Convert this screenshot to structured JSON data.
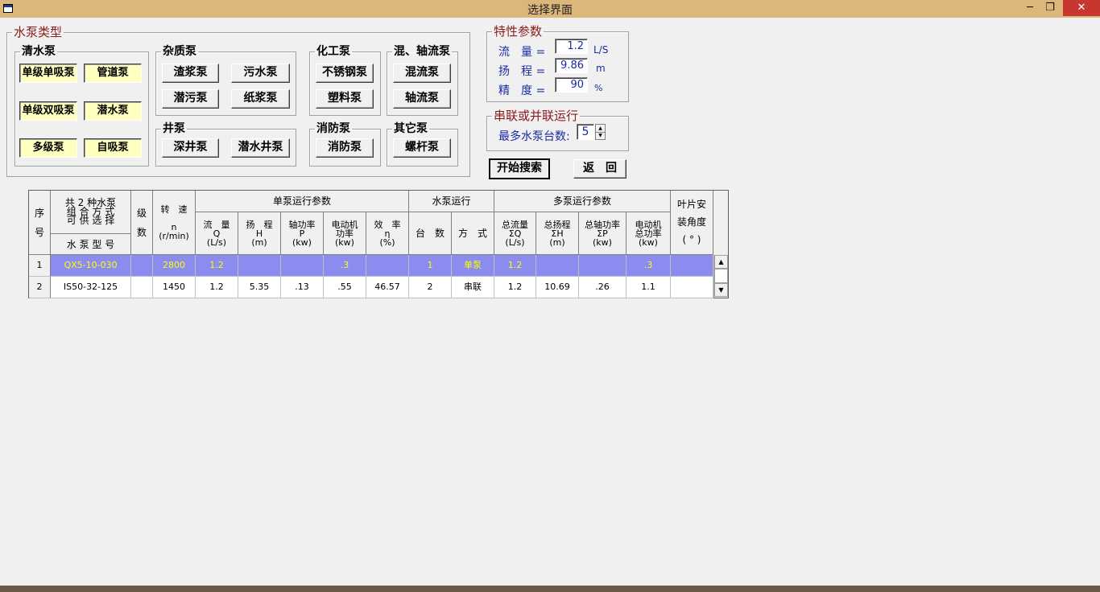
{
  "window": {
    "title": "选择界面",
    "minimize": "─",
    "restore": "❐",
    "close": "✕"
  },
  "pump_type": {
    "legend": "水泵类型",
    "clear_water": {
      "legend": "清水泵",
      "buttons": [
        "单级单吸泵",
        "管道泵",
        "单级双吸泵",
        "潜水泵",
        "多级泵",
        "自吸泵"
      ]
    },
    "impurity": {
      "legend": "杂质泵",
      "buttons": [
        "渣浆泵",
        "污水泵",
        "潜污泵",
        "纸浆泵"
      ]
    },
    "chemical": {
      "legend": "化工泵",
      "buttons": [
        "不锈钢泵",
        "塑料泵"
      ]
    },
    "mixed_axial": {
      "legend": "混、轴流泵",
      "buttons": [
        "混流泵",
        "轴流泵"
      ]
    },
    "well": {
      "legend": "井泵",
      "buttons": [
        "深井泵",
        "潜水井泵"
      ]
    },
    "fire": {
      "legend": "消防泵",
      "buttons": [
        "消防泵"
      ]
    },
    "other": {
      "legend": "其它泵",
      "buttons": [
        "螺杆泵"
      ]
    }
  },
  "params": {
    "legend": "特性参数",
    "flow": {
      "label": "流　量 =",
      "value": "1.2",
      "unit": "L/S"
    },
    "head": {
      "label": "扬　程 =",
      "value": "9.86",
      "unit": "m"
    },
    "precision": {
      "label": "精　度 =",
      "value": "90",
      "unit": "%"
    }
  },
  "series": {
    "legend": "串联或并联运行",
    "label": "最多水泵台数:",
    "value": "5"
  },
  "actions": {
    "search": "开始搜索",
    "back": "返　回"
  },
  "grid": {
    "headers": {
      "seq": "序\n\n号",
      "combo_top": "共 2 种水泵\n组 合 方 式\n可 供 选 择",
      "model": "水 泵 型 号",
      "stage": "级\n\n数",
      "speed": "转　速\n\nn\n(r/min)",
      "single": "单泵运行参数",
      "flow": "流　量\nQ\n(L/s)",
      "head": "扬　程\nH\n(m)",
      "shaft": "轴功率\nP\n(kw)",
      "motor": "电动机\n功率\n(kw)",
      "eff": "效　率\nη\n(%)",
      "pump_run": "水泵运行",
      "count": "台　数",
      "mode": "方　式",
      "multi": "多泵运行参数",
      "tflow": "总流量\nΣQ\n(L/s)",
      "thead": "总扬程\nΣH\n(m)",
      "tshaft": "总轴功率\nΣP\n(kw)",
      "tmotor": "电动机\n总功率\n(kw)",
      "blade": "叶片安\n\n装角度\n\n( ° )"
    },
    "rows": [
      [
        "1",
        "QX5-10-030",
        "",
        "2800",
        "1.2",
        "",
        "",
        ".3",
        "",
        "1",
        "单泵",
        "1.2",
        "",
        "",
        ".3",
        ""
      ],
      [
        "2",
        "IS50-32-125",
        "",
        "1450",
        "1.2",
        "5.35",
        ".13",
        ".55",
        "46.57",
        "2",
        "串联",
        "1.2",
        "10.69",
        ".26",
        "1.1",
        ""
      ]
    ]
  }
}
